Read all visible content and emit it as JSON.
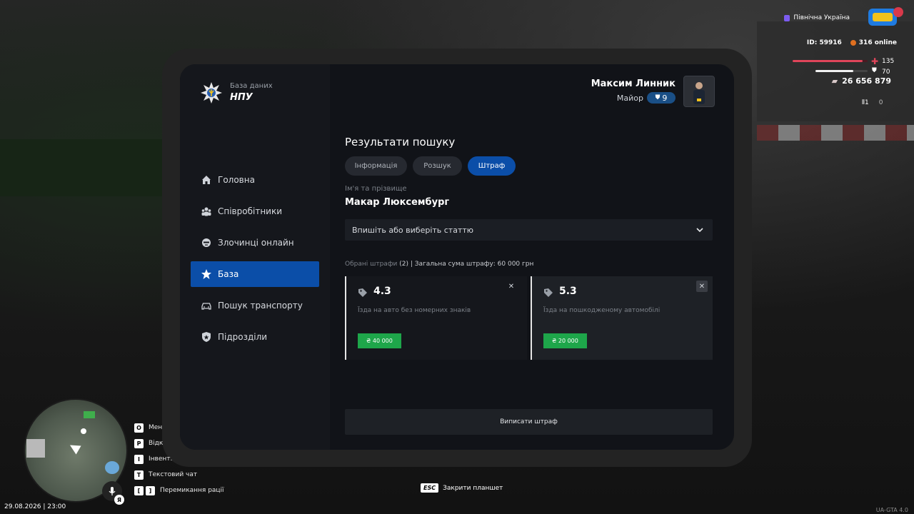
{
  "tablet": {
    "brand": {
      "subtitle": "База даних",
      "title": "НПУ"
    },
    "user": {
      "name": "Максим Линник",
      "rank": "Майор",
      "rank_level": "9"
    },
    "nav": [
      {
        "label": "Головна",
        "icon": "home-icon"
      },
      {
        "label": "Співробітники",
        "icon": "users-icon"
      },
      {
        "label": "Злочинці онлайн",
        "icon": "criminal-icon"
      },
      {
        "label": "База",
        "icon": "star-icon",
        "active": true
      },
      {
        "label": "Пошук транспорту",
        "icon": "car-icon"
      },
      {
        "label": "Підрозділи",
        "icon": "shield-icon"
      }
    ],
    "results_title": "Результати пошуку",
    "tabs": [
      {
        "label": "Інформація"
      },
      {
        "label": "Розшук"
      },
      {
        "label": "Штраф",
        "active": true
      }
    ],
    "field_label": "Ім'я та прізвище",
    "person_name": "Макар Люксембург",
    "article_select_placeholder": "Впишіть або виберіть статтю",
    "summary": {
      "label": "Обрані штрафи",
      "count": "(2)",
      "total": "| Загальна сума штрафу: 60 000 грн"
    },
    "fines": [
      {
        "code": "4.3",
        "description": "Їзда на авто без номерних знаків",
        "price": "₴ 40 000"
      },
      {
        "code": "5.3",
        "description": "Їзда на пошкодженому автомобілі",
        "price": "₴ 20 000"
      }
    ],
    "submit_label": "Виписати штраф"
  },
  "hud": {
    "region": "Північна Україна",
    "player_id": "ID: 59916",
    "online": "316 online",
    "health": "135",
    "armor": "70",
    "health_fraction": 0.93,
    "armor_fraction": 0.72,
    "money": "26 656 879",
    "ammo_clip": "1",
    "ammo_total": "0",
    "datetime": "29.08.2026 | 23:00",
    "lang": "Я",
    "keys": [
      {
        "key": "O",
        "label": "Мен"
      },
      {
        "key": "P",
        "label": "Відк"
      },
      {
        "key": "I",
        "label": "Інвент."
      },
      {
        "key": "T",
        "label": "Текстовий чат"
      },
      {
        "keys": [
          "[",
          "]"
        ],
        "label": "Перемикання рації"
      }
    ],
    "esc_key": "ESC",
    "esc_label": "Закрити планшет",
    "version": "UA-GTA 4.0",
    "colors": {
      "accent": "#0b4ea8",
      "price": "#1ea64a",
      "health": "#e0455a"
    }
  }
}
